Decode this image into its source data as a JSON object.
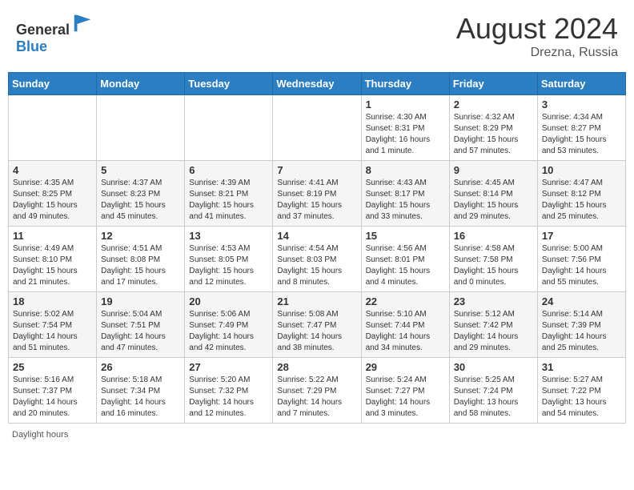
{
  "header": {
    "logo_line1": "General",
    "logo_line2": "Blue",
    "month": "August 2024",
    "location": "Drezna, Russia"
  },
  "days_of_week": [
    "Sunday",
    "Monday",
    "Tuesday",
    "Wednesday",
    "Thursday",
    "Friday",
    "Saturday"
  ],
  "footer": {
    "daylight_label": "Daylight hours"
  },
  "weeks": [
    [
      {
        "day": "",
        "info": ""
      },
      {
        "day": "",
        "info": ""
      },
      {
        "day": "",
        "info": ""
      },
      {
        "day": "",
        "info": ""
      },
      {
        "day": "1",
        "info": "Sunrise: 4:30 AM\nSunset: 8:31 PM\nDaylight: 16 hours\nand 1 minute."
      },
      {
        "day": "2",
        "info": "Sunrise: 4:32 AM\nSunset: 8:29 PM\nDaylight: 15 hours\nand 57 minutes."
      },
      {
        "day": "3",
        "info": "Sunrise: 4:34 AM\nSunset: 8:27 PM\nDaylight: 15 hours\nand 53 minutes."
      }
    ],
    [
      {
        "day": "4",
        "info": "Sunrise: 4:35 AM\nSunset: 8:25 PM\nDaylight: 15 hours\nand 49 minutes."
      },
      {
        "day": "5",
        "info": "Sunrise: 4:37 AM\nSunset: 8:23 PM\nDaylight: 15 hours\nand 45 minutes."
      },
      {
        "day": "6",
        "info": "Sunrise: 4:39 AM\nSunset: 8:21 PM\nDaylight: 15 hours\nand 41 minutes."
      },
      {
        "day": "7",
        "info": "Sunrise: 4:41 AM\nSunset: 8:19 PM\nDaylight: 15 hours\nand 37 minutes."
      },
      {
        "day": "8",
        "info": "Sunrise: 4:43 AM\nSunset: 8:17 PM\nDaylight: 15 hours\nand 33 minutes."
      },
      {
        "day": "9",
        "info": "Sunrise: 4:45 AM\nSunset: 8:14 PM\nDaylight: 15 hours\nand 29 minutes."
      },
      {
        "day": "10",
        "info": "Sunrise: 4:47 AM\nSunset: 8:12 PM\nDaylight: 15 hours\nand 25 minutes."
      }
    ],
    [
      {
        "day": "11",
        "info": "Sunrise: 4:49 AM\nSunset: 8:10 PM\nDaylight: 15 hours\nand 21 minutes."
      },
      {
        "day": "12",
        "info": "Sunrise: 4:51 AM\nSunset: 8:08 PM\nDaylight: 15 hours\nand 17 minutes."
      },
      {
        "day": "13",
        "info": "Sunrise: 4:53 AM\nSunset: 8:05 PM\nDaylight: 15 hours\nand 12 minutes."
      },
      {
        "day": "14",
        "info": "Sunrise: 4:54 AM\nSunset: 8:03 PM\nDaylight: 15 hours\nand 8 minutes."
      },
      {
        "day": "15",
        "info": "Sunrise: 4:56 AM\nSunset: 8:01 PM\nDaylight: 15 hours\nand 4 minutes."
      },
      {
        "day": "16",
        "info": "Sunrise: 4:58 AM\nSunset: 7:58 PM\nDaylight: 15 hours\nand 0 minutes."
      },
      {
        "day": "17",
        "info": "Sunrise: 5:00 AM\nSunset: 7:56 PM\nDaylight: 14 hours\nand 55 minutes."
      }
    ],
    [
      {
        "day": "18",
        "info": "Sunrise: 5:02 AM\nSunset: 7:54 PM\nDaylight: 14 hours\nand 51 minutes."
      },
      {
        "day": "19",
        "info": "Sunrise: 5:04 AM\nSunset: 7:51 PM\nDaylight: 14 hours\nand 47 minutes."
      },
      {
        "day": "20",
        "info": "Sunrise: 5:06 AM\nSunset: 7:49 PM\nDaylight: 14 hours\nand 42 minutes."
      },
      {
        "day": "21",
        "info": "Sunrise: 5:08 AM\nSunset: 7:47 PM\nDaylight: 14 hours\nand 38 minutes."
      },
      {
        "day": "22",
        "info": "Sunrise: 5:10 AM\nSunset: 7:44 PM\nDaylight: 14 hours\nand 34 minutes."
      },
      {
        "day": "23",
        "info": "Sunrise: 5:12 AM\nSunset: 7:42 PM\nDaylight: 14 hours\nand 29 minutes."
      },
      {
        "day": "24",
        "info": "Sunrise: 5:14 AM\nSunset: 7:39 PM\nDaylight: 14 hours\nand 25 minutes."
      }
    ],
    [
      {
        "day": "25",
        "info": "Sunrise: 5:16 AM\nSunset: 7:37 PM\nDaylight: 14 hours\nand 20 minutes."
      },
      {
        "day": "26",
        "info": "Sunrise: 5:18 AM\nSunset: 7:34 PM\nDaylight: 14 hours\nand 16 minutes."
      },
      {
        "day": "27",
        "info": "Sunrise: 5:20 AM\nSunset: 7:32 PM\nDaylight: 14 hours\nand 12 minutes."
      },
      {
        "day": "28",
        "info": "Sunrise: 5:22 AM\nSunset: 7:29 PM\nDaylight: 14 hours\nand 7 minutes."
      },
      {
        "day": "29",
        "info": "Sunrise: 5:24 AM\nSunset: 7:27 PM\nDaylight: 14 hours\nand 3 minutes."
      },
      {
        "day": "30",
        "info": "Sunrise: 5:25 AM\nSunset: 7:24 PM\nDaylight: 13 hours\nand 58 minutes."
      },
      {
        "day": "31",
        "info": "Sunrise: 5:27 AM\nSunset: 7:22 PM\nDaylight: 13 hours\nand 54 minutes."
      }
    ]
  ]
}
